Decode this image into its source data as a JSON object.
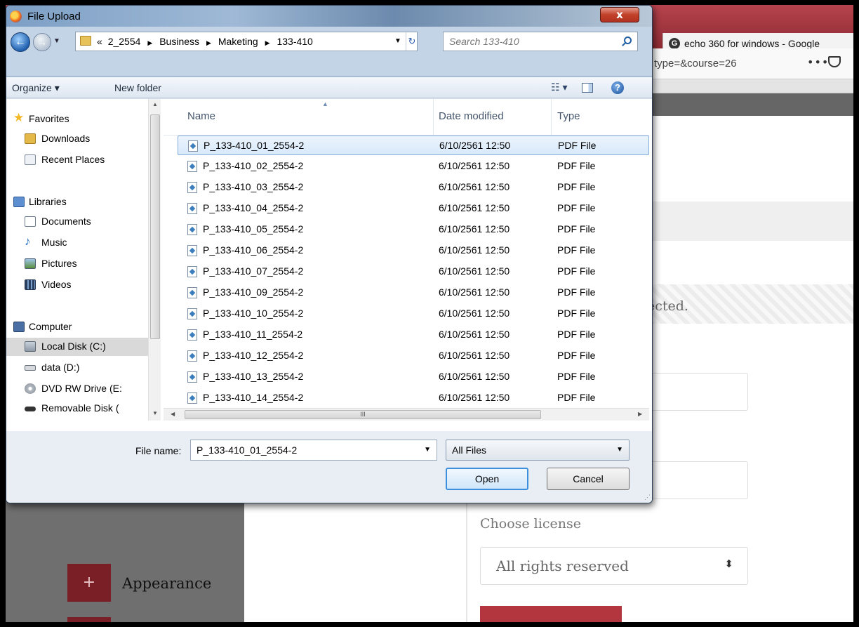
{
  "background": {
    "browser_tab_title": "echo 360 for windows - Google",
    "url_fragment": "type=&course=26",
    "hatched_text": "ected.",
    "license_label": "Choose license",
    "license_value": "All rights reserved",
    "sidebar_appearance_label": "Appearance",
    "plus_symbol": "+"
  },
  "dialog": {
    "title": "File Upload",
    "close_label": "x",
    "breadcrumbs": {
      "overflow": "«",
      "items": [
        "2_2554",
        "Business",
        "Maketing",
        "133-410"
      ]
    },
    "search_placeholder": "Search 133-410",
    "toolbar": {
      "organize_label": "Organize ▾",
      "new_folder_label": "New folder"
    },
    "nav_pane": [
      {
        "label": "Favorites",
        "icon": "star-icon"
      },
      {
        "label": "Downloads",
        "icon": "downloads-folder-icon"
      },
      {
        "label": "Recent Places",
        "icon": "recent-places-icon"
      },
      {
        "label": "Libraries",
        "icon": "libraries-icon"
      },
      {
        "label": "Documents",
        "icon": "documents-icon"
      },
      {
        "label": "Music",
        "icon": "music-icon"
      },
      {
        "label": "Pictures",
        "icon": "pictures-icon"
      },
      {
        "label": "Videos",
        "icon": "videos-icon"
      },
      {
        "label": "Computer",
        "icon": "computer-icon"
      },
      {
        "label": "Local Disk (C:)",
        "icon": "local-disk-icon",
        "selected": true
      },
      {
        "label": "data (D:)",
        "icon": "drive-icon"
      },
      {
        "label": "DVD RW Drive (E:",
        "icon": "dvd-drive-icon"
      },
      {
        "label": "Removable Disk (",
        "icon": "removable-disk-icon"
      }
    ],
    "columns": {
      "name": "Name",
      "date": "Date modified",
      "type": "Type"
    },
    "files": [
      {
        "name": "P_133-410_01_2554-2",
        "date": "6/10/2561 12:50",
        "type": "PDF File"
      },
      {
        "name": "P_133-410_02_2554-2",
        "date": "6/10/2561 12:50",
        "type": "PDF File"
      },
      {
        "name": "P_133-410_03_2554-2",
        "date": "6/10/2561 12:50",
        "type": "PDF File"
      },
      {
        "name": "P_133-410_04_2554-2",
        "date": "6/10/2561 12:50",
        "type": "PDF File"
      },
      {
        "name": "P_133-410_05_2554-2",
        "date": "6/10/2561 12:50",
        "type": "PDF File"
      },
      {
        "name": "P_133-410_06_2554-2",
        "date": "6/10/2561 12:50",
        "type": "PDF File"
      },
      {
        "name": "P_133-410_07_2554-2",
        "date": "6/10/2561 12:50",
        "type": "PDF File"
      },
      {
        "name": "P_133-410_09_2554-2",
        "date": "6/10/2561 12:50",
        "type": "PDF File"
      },
      {
        "name": "P_133-410_10_2554-2",
        "date": "6/10/2561 12:50",
        "type": "PDF File"
      },
      {
        "name": "P_133-410_11_2554-2",
        "date": "6/10/2561 12:50",
        "type": "PDF File"
      },
      {
        "name": "P_133-410_12_2554-2",
        "date": "6/10/2561 12:50",
        "type": "PDF File"
      },
      {
        "name": "P_133-410_13_2554-2",
        "date": "6/10/2561 12:50",
        "type": "PDF File"
      },
      {
        "name": "P_133-410_14_2554-2",
        "date": "6/10/2561 12:50",
        "type": "PDF File"
      }
    ],
    "selected_file_index": 0,
    "filename_label": "File name:",
    "filename_value": "P_133-410_01_2554-2",
    "filetype_value": "All Files",
    "open_label": "Open",
    "cancel_label": "Cancel"
  },
  "colors": {
    "browser_accent": "#b3363f",
    "selection_blue": "#84acdd",
    "dialog_frame": "#c3d4e7"
  }
}
